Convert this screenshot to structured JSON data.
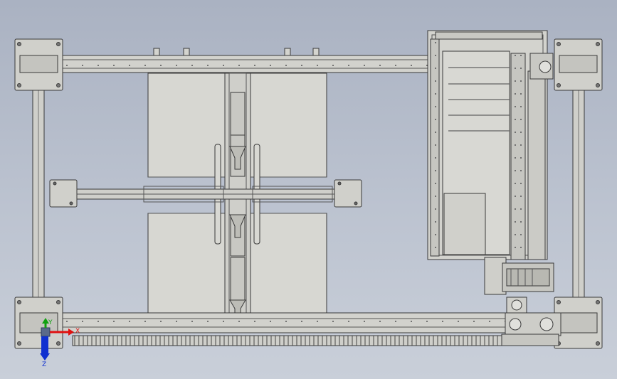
{
  "viewport": {
    "background_top": "#aab2c2",
    "background_bottom": "#c9cfd9",
    "part_fill": "#d4d4cf",
    "part_fill_dark": "#bdbdb7",
    "edge_color": "#3a3a3a"
  },
  "triad": {
    "x_label": "X",
    "y_label": "Y",
    "z_label": "Z",
    "x_color": "#e01010",
    "y_color": "#10a010",
    "z_color": "#1030d0"
  }
}
